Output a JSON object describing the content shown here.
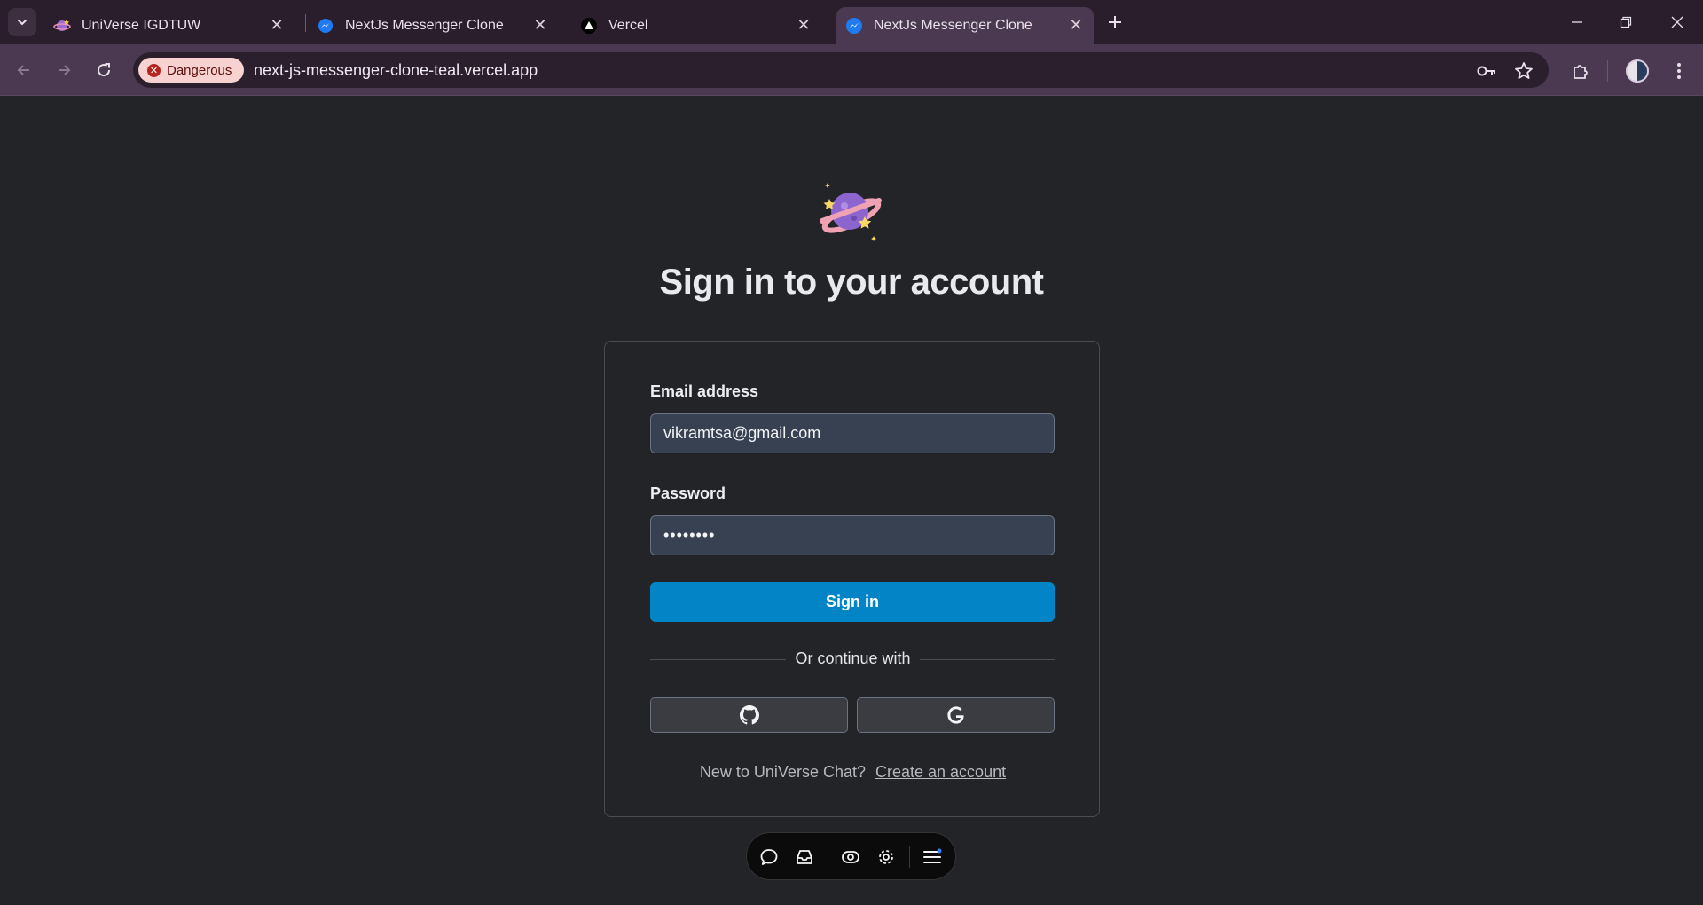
{
  "browser": {
    "tabs": [
      {
        "title": "UniVerse IGDTUW",
        "favicon": "universe-favicon",
        "active": false
      },
      {
        "title": "NextJs Messenger Clone",
        "favicon": "messenger-favicon",
        "active": false
      },
      {
        "title": "Vercel",
        "favicon": "vercel-favicon",
        "active": false
      },
      {
        "title": "NextJs Messenger Clone",
        "favicon": "messenger-favicon",
        "active": true
      }
    ],
    "security_chip": "Dangerous",
    "url": "next-js-messenger-clone-teal.vercel.app"
  },
  "page": {
    "title": "Sign in to your account",
    "form": {
      "email_label": "Email address",
      "email_value": "vikramtsa@gmail.com",
      "password_label": "Password",
      "password_value": "••••••••",
      "submit_label": "Sign in",
      "divider_text": "Or continue with",
      "social": [
        "github-icon",
        "google-icon"
      ],
      "signup_prompt": "New to UniVerse Chat?",
      "signup_link": "Create an account"
    }
  },
  "floating_toolbar": {
    "icons": [
      "comment-icon",
      "inbox-icon",
      "eye-toggle-icon",
      "settings-icon",
      "menu-icon"
    ]
  },
  "colors": {
    "accent": "#0284c7",
    "danger_chip_bg": "#f8d2d0",
    "page_bg": "#232427"
  }
}
